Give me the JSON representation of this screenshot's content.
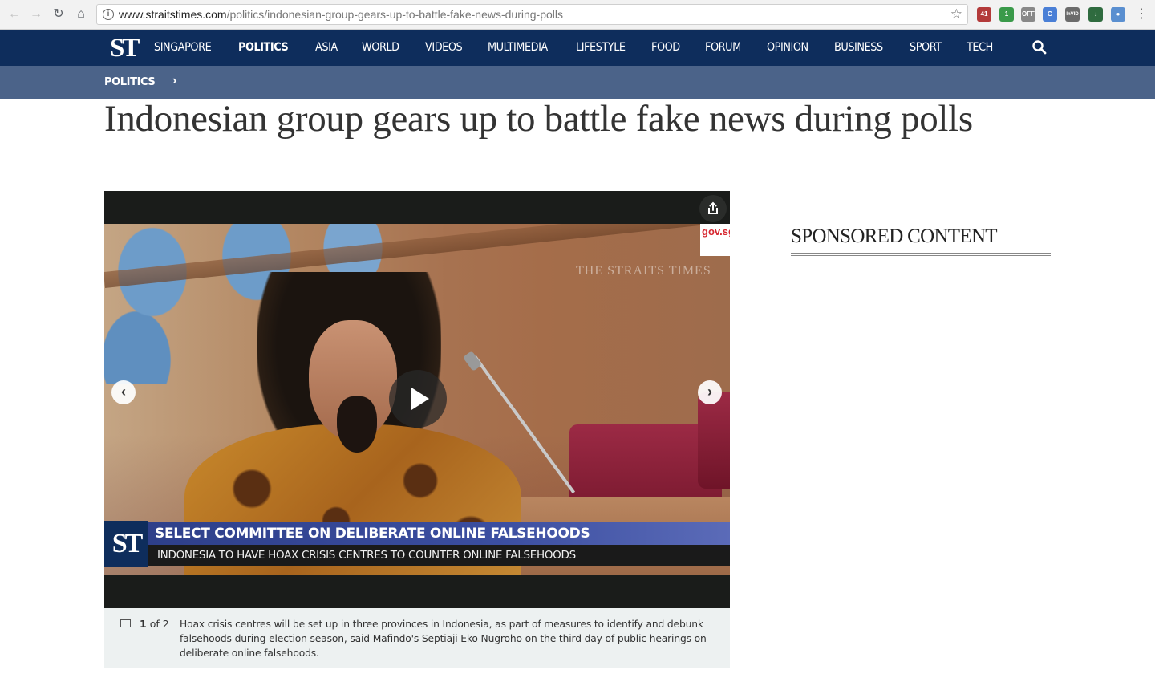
{
  "browser": {
    "url_host": "www.straitstimes.com",
    "url_path": "/politics/indonesian-group-gears-up-to-battle-fake-news-during-polls",
    "extensions": [
      {
        "name": "calendar-extension-icon",
        "badge": "41",
        "color": "#b33a3a"
      },
      {
        "name": "green-extension-icon",
        "badge": "1",
        "color": "#3a9a4a"
      },
      {
        "name": "off-extension-icon",
        "badge": "OFF",
        "color": "#888888"
      },
      {
        "name": "translate-extension-icon",
        "badge": "G",
        "color": "#4a7fd6"
      },
      {
        "name": "invid-extension-icon",
        "badge": "InVID",
        "color": "#6b6b6b"
      },
      {
        "name": "download-extension-icon",
        "badge": "↓",
        "color": "#2f6b3f"
      },
      {
        "name": "eye-extension-icon",
        "badge": "●",
        "color": "#5a8fd0"
      }
    ]
  },
  "site": {
    "logo": "ST",
    "nav": [
      "SINGAPORE",
      "POLITICS",
      "ASIA",
      "WORLD",
      "VIDEOS",
      "MULTIMEDIA",
      "LIFESTYLE",
      "FOOD",
      "FORUM",
      "OPINION",
      "BUSINESS",
      "SPORT",
      "TECH"
    ],
    "active_nav": "POLITICS",
    "breadcrumb": "POLITICS"
  },
  "article": {
    "headline": "Indonesian group gears up to battle fake news during polls"
  },
  "video": {
    "watermark": "THE STRAITS TIMES",
    "gov_badge": "gov.sg",
    "lower_third_logo": "ST",
    "lower_third_title": "SELECT COMMITTEE ON DELIBERATE ONLINE FALSEHOODS",
    "lower_third_subtitle": "INDONESIA TO HAVE HOAX CRISIS CENTRES TO COUNTER ONLINE FALSEHOODS"
  },
  "caption": {
    "current": "1",
    "total_label": "of 2",
    "text": "Hoax crisis centres will be set up in three provinces in Indonesia, as part of measures to identify and debunk falsehoods during election season, said Mafindo's Septiaji Eko Nugroho on the third day of public hearings on deliberate online falsehoods."
  },
  "sidebar": {
    "sponsored_title": "SPONSORED CONTENT"
  }
}
